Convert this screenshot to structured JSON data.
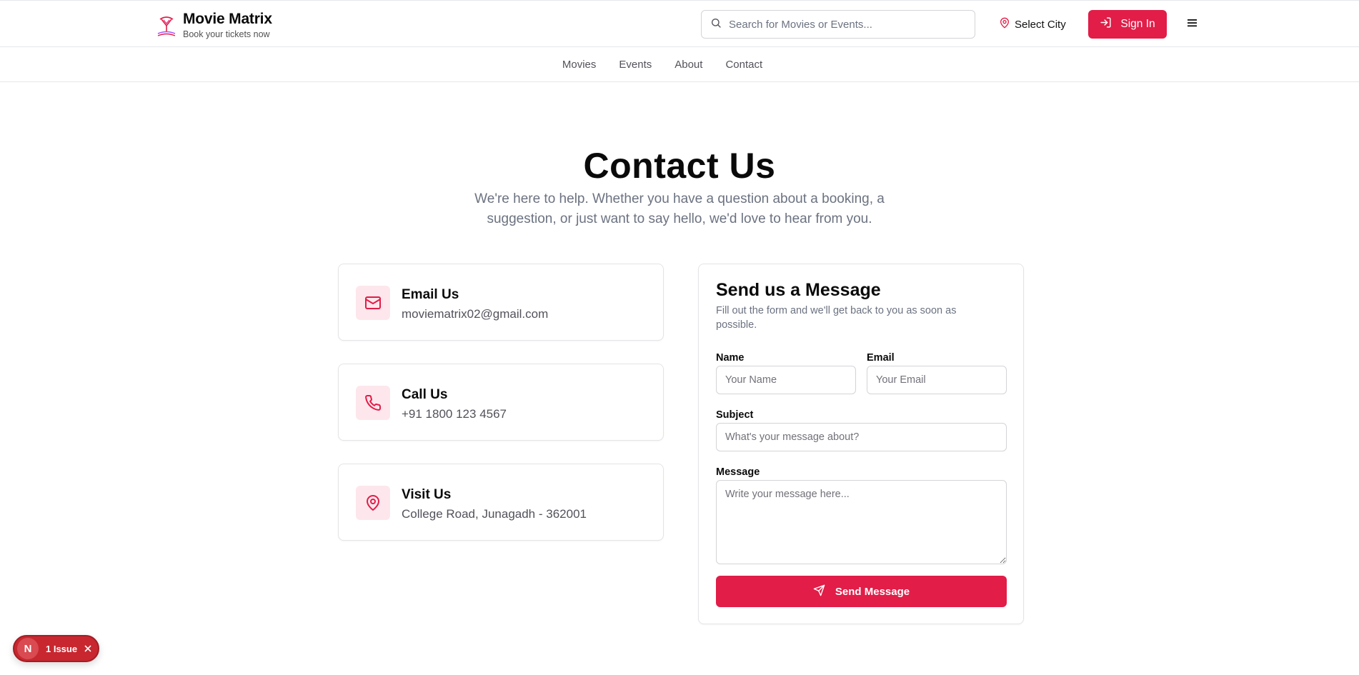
{
  "header": {
    "brand_name": "Movie Matrix",
    "brand_tagline": "Book your tickets now",
    "search_placeholder": "Search for Movies or Events...",
    "city_label": "Select City",
    "signin_label": "Sign In"
  },
  "nav": {
    "items": [
      {
        "label": "Movies"
      },
      {
        "label": "Events"
      },
      {
        "label": "About"
      },
      {
        "label": "Contact"
      }
    ]
  },
  "hero": {
    "title": "Contact Us",
    "subtitle": "We're here to help. Whether you have a question about a booking, a suggestion, or just want to say hello, we'd love to hear from you."
  },
  "contact_cards": [
    {
      "title": "Email Us",
      "value": "moviematrix02@gmail.com",
      "icon": "mail-icon"
    },
    {
      "title": "Call Us",
      "value": "+91 1800 123 4567",
      "icon": "phone-icon"
    },
    {
      "title": "Visit Us",
      "value": "College Road, Junagadh - 362001",
      "icon": "map-pin-icon"
    }
  ],
  "form": {
    "title": "Send us a Message",
    "description": "Fill out the form and we'll get back to you as soon as possible.",
    "name_label": "Name",
    "name_placeholder": "Your Name",
    "email_label": "Email",
    "email_placeholder": "Your Email",
    "subject_label": "Subject",
    "subject_placeholder": "What's your message about?",
    "message_label": "Message",
    "message_placeholder": "Write your message here...",
    "submit_label": "Send Message"
  },
  "dev_indicator": {
    "badge_letter": "N",
    "label": "1 Issue"
  },
  "colors": {
    "accent": "#e11d48",
    "accent_soft": "#fde7ec",
    "text_muted": "#6b7280",
    "issue_badge": "#c8272f"
  }
}
